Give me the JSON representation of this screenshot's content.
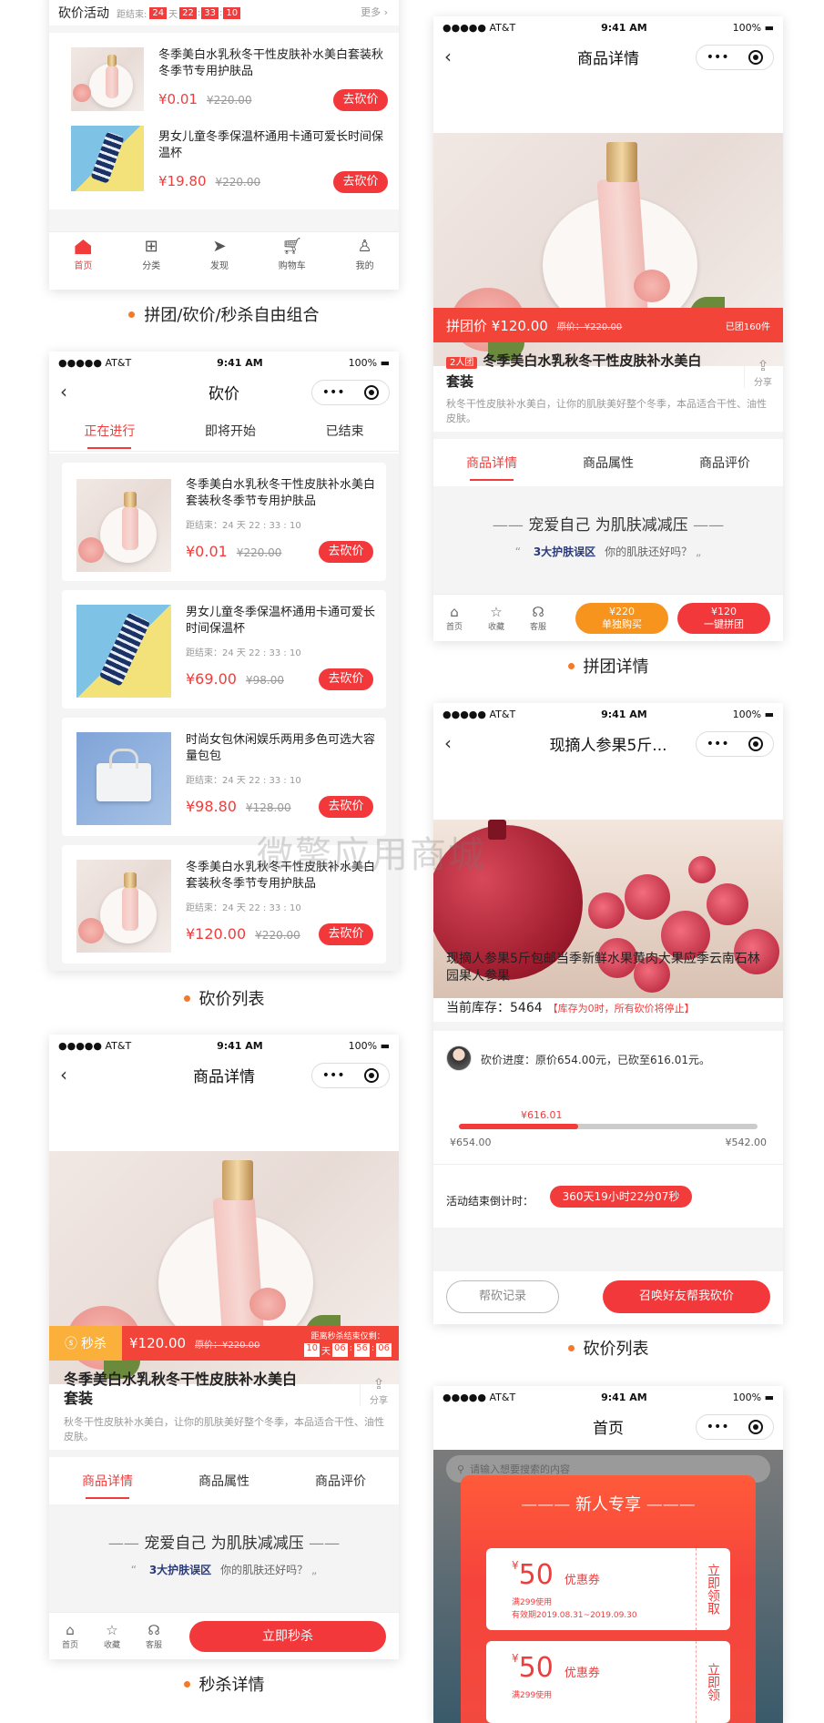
{
  "p1": {
    "section": "砍价活动",
    "end_label": "距结束:",
    "cd": [
      "24",
      "天",
      "22",
      "33",
      "10"
    ],
    "more": "更多",
    "items": [
      {
        "title": "冬季美白水乳秋冬干性皮肤补水美白套装秋冬季节专用护肤品",
        "price": "¥0.01",
        "old": "¥220.00",
        "btn": "去砍价"
      },
      {
        "title": "男女儿童冬季保温杯通用卡通可爱长时间保温杯",
        "price": "¥19.80",
        "old": "¥220.00",
        "btn": "去砍价"
      }
    ],
    "tabbar": [
      "首页",
      "分类",
      "发现",
      "购物车",
      "我的"
    ]
  },
  "cap1": "拼团/砍价/秒杀自由组合",
  "status": {
    "carrier": "●●●●● AT&T",
    "time": "9:41 AM",
    "battery": "100%"
  },
  "p2": {
    "title": "砍价",
    "tabs": [
      "正在进行",
      "即将开始",
      "已结束"
    ],
    "items": [
      {
        "title": "冬季美白水乳秋冬干性皮肤补水美白套装秋冬季节专用护肤品",
        "cd": "距结束：24 天 22 : 33 : 10",
        "price": "¥0.01",
        "old": "¥220.00",
        "btn": "去砍价"
      },
      {
        "title": "男女儿童冬季保温杯通用卡通可爱长时间保温杯",
        "cd": "距结束：24 天 22 : 33 : 10",
        "price": "¥69.00",
        "old": "¥98.00",
        "btn": "去砍价"
      },
      {
        "title": "时尚女包休闲娱乐两用多色可选大容量包包",
        "cd": "距结束：24 天 22 : 33 : 10",
        "price": "¥98.80",
        "old": "¥128.00",
        "btn": "去砍价"
      },
      {
        "title": "冬季美白水乳秋冬干性皮肤补水美白套装秋冬季节专用护肤品",
        "cd": "距结束：24 天 22 : 33 : 10",
        "price": "¥120.00",
        "old": "¥220.00",
        "btn": "去砍价"
      }
    ]
  },
  "cap2": "砍价列表",
  "p3": {
    "title": "商品详情",
    "badge": "秒杀",
    "price": "¥120.00",
    "old_label": "原价：¥220.00",
    "end_label": "距离秒杀结束仅剩：",
    "cd": [
      "10",
      "天",
      "06",
      "56",
      "06"
    ],
    "name": "冬季美白水乳秋冬干性皮肤补水美白套装",
    "desc": "秋冬干性皮肤补水美白，让你的肌肤美好整个冬季，本品适合干性、油性皮肤。",
    "share": "分享",
    "tabs": [
      "商品详情",
      "商品属性",
      "商品评价"
    ],
    "slogan": "宠爱自己 为肌肤减减压",
    "sub_hl": "3大护肤误区",
    "sub": "你的肌肤还好吗？",
    "foot": [
      "首页",
      "收藏",
      "客服"
    ],
    "buy": "立即秒杀"
  },
  "cap3": "秒杀详情",
  "p4": {
    "title": "商品详情",
    "group_price": "拼团价 ¥120.00",
    "old_label": "原价：¥220.00",
    "joined": "已团160件",
    "tag": "2人团",
    "name": "冬季美白水乳秋冬干性皮肤补水美白套装",
    "desc": "秋冬干性皮肤补水美白，让你的肌肤美好整个冬季，本品适合干性、油性皮肤。",
    "share": "分享",
    "tabs": [
      "商品详情",
      "商品属性",
      "商品评价"
    ],
    "slogan": "宠爱自己 为肌肤减减压",
    "sub_hl": "3大护肤误区",
    "sub": "你的肌肤还好吗？",
    "foot": [
      "首页",
      "收藏",
      "客服"
    ],
    "single_price": "¥220",
    "single": "单独购买",
    "group_btn_price": "¥120",
    "group_btn": "一键拼团"
  },
  "cap4": "拼团详情",
  "p5": {
    "title": "现摘人参果5斤...",
    "name": "现摘人参果5斤包邮当季新鲜水果黄肉大果应季云南石林园果人参果",
    "stock_label": "当前库存：",
    "stock": "5464",
    "stock_note": "【库存为0时，所有砍价将停止】",
    "progress": "砍价进度：原价654.00元，已砍至616.01元。",
    "cur": "¥616.01",
    "start": "¥654.00",
    "end": "¥542.00",
    "progress_frac": 0.4,
    "cd_label": "活动结束倒计时：",
    "cd": "360天19小时22分07秒",
    "help": "帮砍记录",
    "invite": "召唤好友帮我砍价"
  },
  "cap5": "砍价列表",
  "p6": {
    "title": "首页",
    "search": "请输入想要搜索的内容",
    "popup": "新人专享",
    "coupons": [
      {
        "amt": "50",
        "label": "优惠券",
        "cond": "满299使用",
        "valid": "有效期2019.08.31~2019.09.30",
        "btn": "立即领取"
      },
      {
        "amt": "50",
        "label": "优惠券",
        "cond": "满299使用",
        "btn": "立即领"
      }
    ]
  },
  "watermark": "微擎应用商城"
}
